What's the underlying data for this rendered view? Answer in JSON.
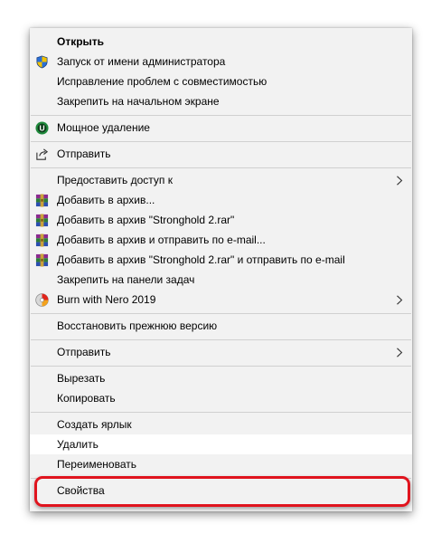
{
  "menu": {
    "items": [
      {
        "label": "Открыть",
        "icon": "",
        "bold": true
      },
      {
        "label": "Запуск от имени администратора",
        "icon": "uac-shield-icon"
      },
      {
        "label": "Исправление проблем с совместимостью",
        "icon": ""
      },
      {
        "label": "Закрепить на начальном экране",
        "icon": ""
      },
      {
        "label": "Мощное удаление",
        "icon": "uninstaller-icon"
      },
      {
        "label": "Отправить",
        "icon": "share-icon"
      },
      {
        "label": "Предоставить доступ к",
        "icon": "",
        "submenu": true
      },
      {
        "label": "Добавить в архив...",
        "icon": "winrar-icon"
      },
      {
        "label": "Добавить в архив \"Stronghold 2.rar\"",
        "icon": "winrar-icon"
      },
      {
        "label": "Добавить в архив и отправить по e-mail...",
        "icon": "winrar-icon"
      },
      {
        "label": "Добавить в архив \"Stronghold 2.rar\" и отправить по e-mail",
        "icon": "winrar-icon"
      },
      {
        "label": "Закрепить на панели задач",
        "icon": ""
      },
      {
        "label": "Burn with Nero 2019",
        "icon": "nero-icon",
        "submenu": true
      },
      {
        "label": "Восстановить прежнюю версию",
        "icon": ""
      },
      {
        "label": "Отправить",
        "icon": "",
        "submenu": true
      },
      {
        "label": "Вырезать",
        "icon": ""
      },
      {
        "label": "Копировать",
        "icon": ""
      },
      {
        "label": "Создать ярлык",
        "icon": ""
      },
      {
        "label": "Удалить",
        "icon": "",
        "hovered": true
      },
      {
        "label": "Переименовать",
        "icon": ""
      },
      {
        "label": "Свойства",
        "icon": "",
        "highlighted": true
      }
    ]
  },
  "colors": {
    "menu_background": "#f2f2f2",
    "hover_background": "#ffffff",
    "separator": "#d0d0d0",
    "highlight_border": "#e0141e"
  }
}
